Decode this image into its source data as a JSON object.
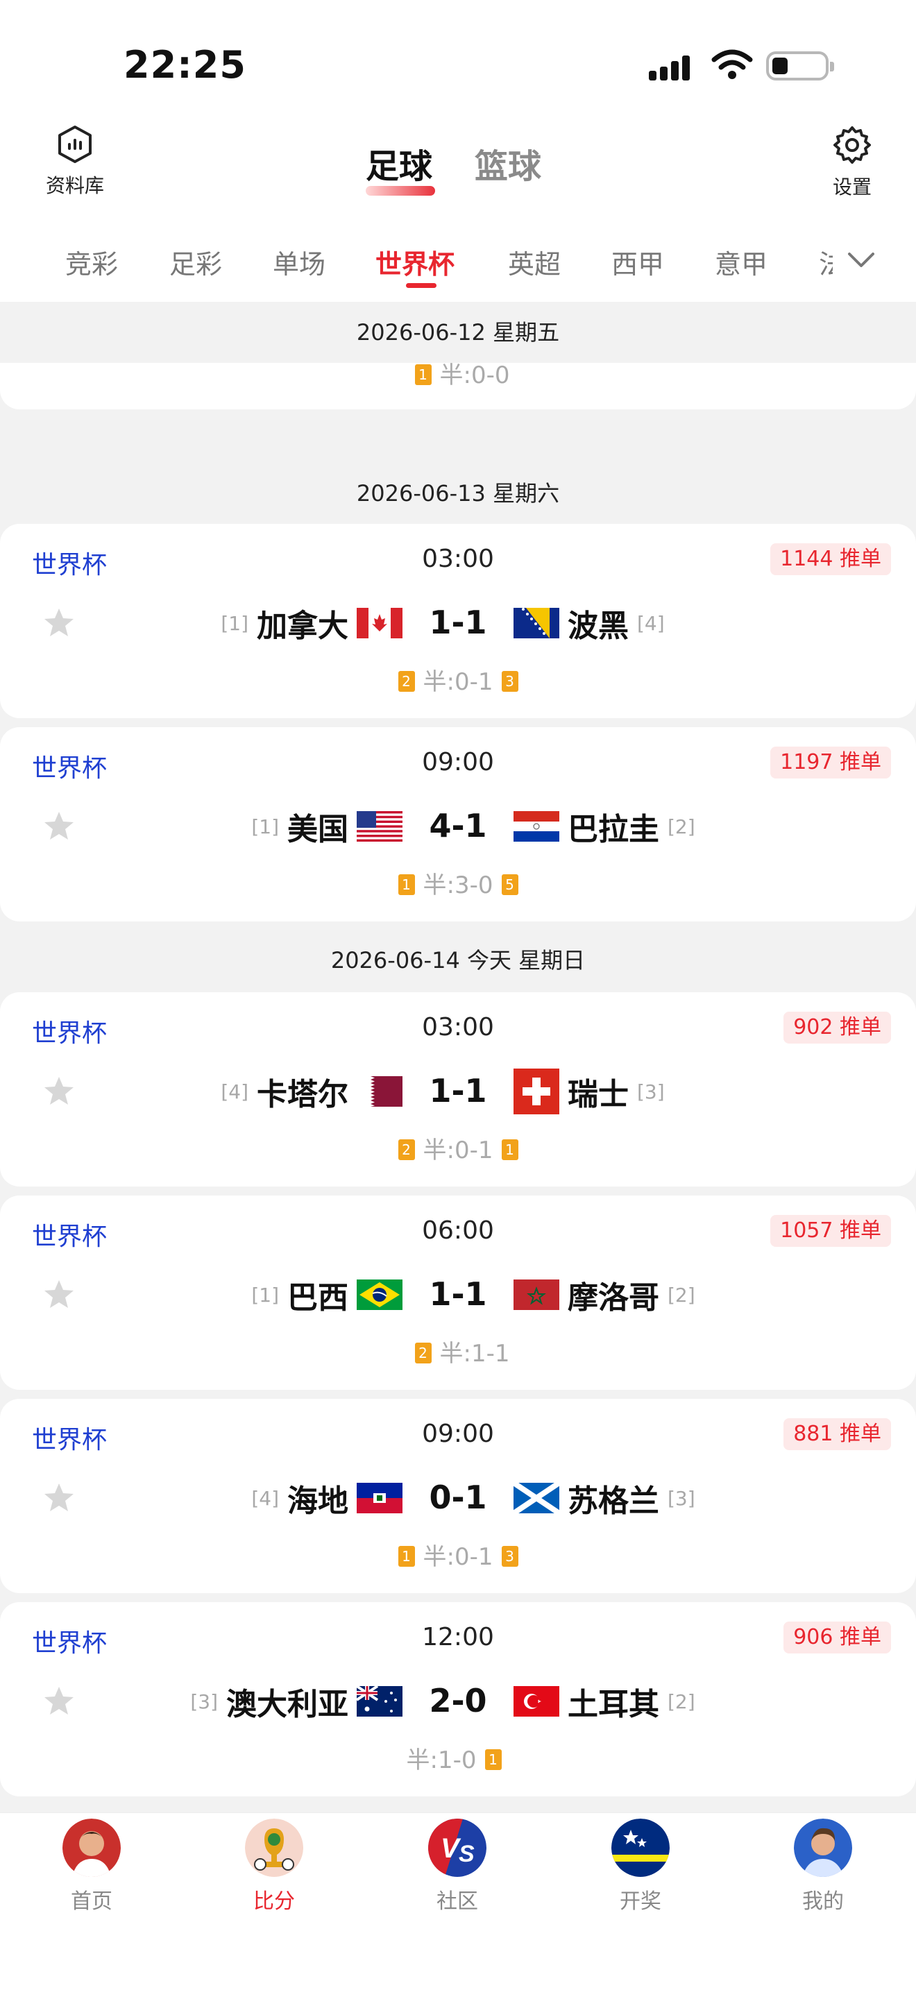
{
  "status": {
    "time": "22:25"
  },
  "header": {
    "left_label": "资料库",
    "right_label": "设置",
    "sports": [
      {
        "label": "足球",
        "active": true
      },
      {
        "label": "篮球",
        "active": false
      }
    ]
  },
  "leagues": [
    "竞彩",
    "足彩",
    "单场",
    "世界杯",
    "英超",
    "西甲",
    "意甲",
    "法"
  ],
  "active_league": "世界杯",
  "partial_card": {
    "half": "半:0-0",
    "home_card": "1"
  },
  "dates": [
    "2026-06-12  星期五",
    "2026-06-13  星期六",
    "2026-06-14 今天  星期日"
  ],
  "matches": [
    {
      "league": "世界杯",
      "time": "03:00",
      "recommend": "1144 推单",
      "home": "加拿大",
      "home_rank": "[1]",
      "away": "波黑",
      "away_rank": "[4]",
      "score": "1-1",
      "half": "半:0-1",
      "home_card": "2",
      "away_card": "3",
      "home_flag": "canada",
      "away_flag": "bosnia"
    },
    {
      "league": "世界杯",
      "time": "09:00",
      "recommend": "1197 推单",
      "home": "美国",
      "home_rank": "[1]",
      "away": "巴拉圭",
      "away_rank": "[2]",
      "score": "4-1",
      "half": "半:3-0",
      "home_card": "1",
      "away_card": "5",
      "home_flag": "usa",
      "away_flag": "paraguay"
    },
    {
      "league": "世界杯",
      "time": "03:00",
      "recommend": "902 推单",
      "home": "卡塔尔",
      "home_rank": "[4]",
      "away": "瑞士",
      "away_rank": "[3]",
      "score": "1-1",
      "half": "半:0-1",
      "home_card": "2",
      "away_card": "1",
      "home_flag": "qatar",
      "away_flag": "switzerland"
    },
    {
      "league": "世界杯",
      "time": "06:00",
      "recommend": "1057 推单",
      "home": "巴西",
      "home_rank": "[1]",
      "away": "摩洛哥",
      "away_rank": "[2]",
      "score": "1-1",
      "half": "半:1-1",
      "home_card": "2",
      "away_card": "",
      "home_flag": "brazil",
      "away_flag": "morocco"
    },
    {
      "league": "世界杯",
      "time": "09:00",
      "recommend": "881 推单",
      "home": "海地",
      "home_rank": "[4]",
      "away": "苏格兰",
      "away_rank": "[3]",
      "score": "0-1",
      "half": "半:0-1",
      "home_card": "1",
      "away_card": "3",
      "home_flag": "haiti",
      "away_flag": "scotland"
    },
    {
      "league": "世界杯",
      "time": "12:00",
      "recommend": "906 推单",
      "home": "澳大利亚",
      "home_rank": "[3]",
      "away": "土耳其",
      "away_rank": "[2]",
      "score": "2-0",
      "half": "半:1-0",
      "home_card": "",
      "away_card": "1",
      "home_flag": "australia",
      "away_flag": "turkey"
    }
  ],
  "bottom_nav": [
    {
      "label": "首页",
      "active": false,
      "icon": "avatar-player"
    },
    {
      "label": "比分",
      "active": true,
      "icon": "trophy"
    },
    {
      "label": "社区",
      "active": false,
      "icon": "vs"
    },
    {
      "label": "开奖",
      "active": false,
      "icon": "curacao-flag"
    },
    {
      "label": "我的",
      "active": false,
      "icon": "avatar-player-2"
    }
  ]
}
